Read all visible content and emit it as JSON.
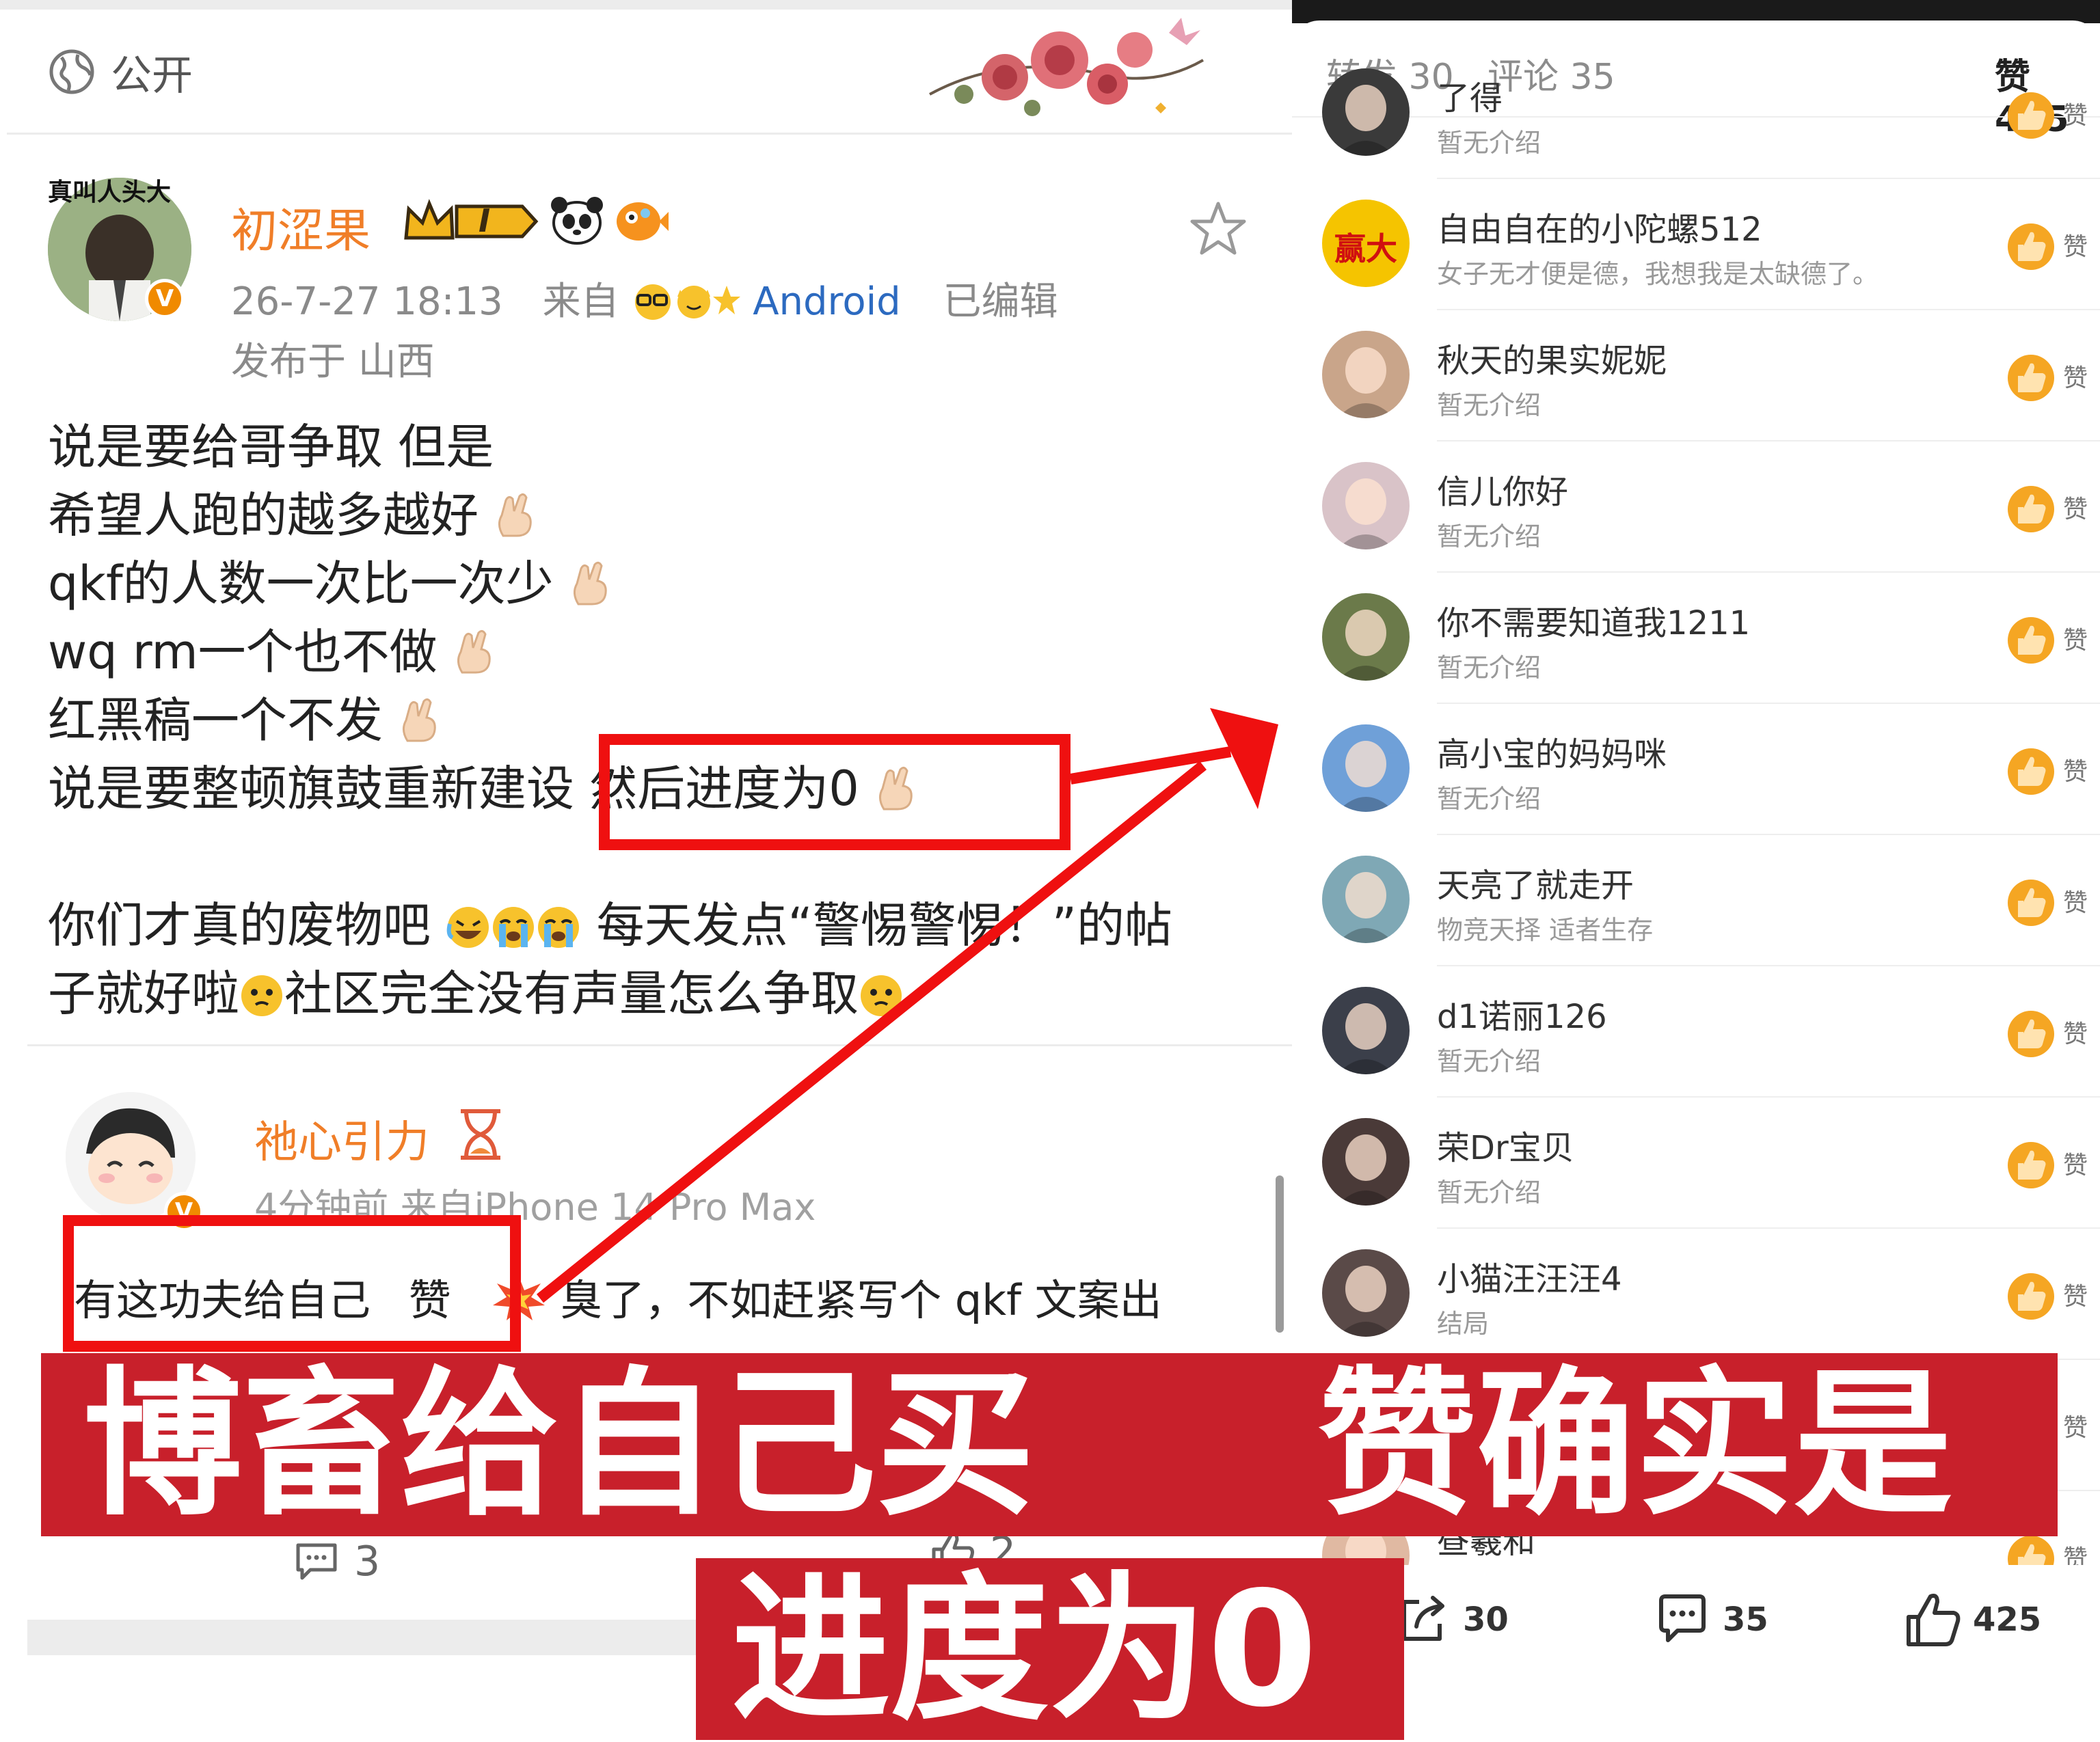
{
  "left_post": {
    "visibility": "公开",
    "author": "初涩果",
    "avatar_caption": "真叫人头大",
    "rank_badge": "I",
    "timestamp": "26-7-27 18:13",
    "source_prefix": "来自",
    "source_device": "Android",
    "edited": "已编辑",
    "location": "发布于 山西",
    "lines": [
      "说是要给哥争取 但是",
      "希望人跑的越多越好",
      "qkf的人数一次比一次少",
      "wq rm一个也不做",
      "红黑稿一个不发",
      "说是要整顿旗鼓重新建设 然后进度为0",
      "",
      "你们才真的废物吧",
      "每天发点“警惕警惕！”的帖",
      "子就好啦",
      "社区完全没有声量怎么争取"
    ],
    "highlight_text": "然后进度为0"
  },
  "comment": {
    "author": "祂心引力",
    "meta": "4分钟前  来自iPhone 14 Pro Max",
    "text_part1": "有这功夫给自己",
    "text_part2": "赞",
    "text_part3": "臭了，不如赶紧写个 qkf 文案出",
    "reply_count": "3",
    "like_count": "2"
  },
  "right_panel": {
    "tabs": [
      {
        "label": "转发 30"
      },
      {
        "label": "评论 35"
      },
      {
        "label": "赞 425"
      }
    ],
    "like_label": "赞",
    "users": [
      {
        "name": "了得",
        "desc": "暂无介绍",
        "color": "#3a3a3a"
      },
      {
        "name": "自由自在的小陀螺512",
        "desc": "女子无才便是德，我想我是太缺德了。",
        "color": "#f5c400",
        "avatar_text": "赢大"
      },
      {
        "name": "秋天的果实妮妮",
        "desc": "暂无介绍",
        "color": "#c9a58a"
      },
      {
        "name": "信儿你好",
        "desc": "暂无介绍",
        "color": "#d9c3c8"
      },
      {
        "name": "你不需要知道我1211",
        "desc": "暂无介绍",
        "color": "#6b7a4a"
      },
      {
        "name": "高小宝的妈妈咪",
        "desc": "暂无介绍",
        "color": "#6fa0d8"
      },
      {
        "name": "天亮了就走开",
        "desc": "物竞天择 适者生存",
        "color": "#7fa8b5"
      },
      {
        "name": "d1诺丽126",
        "desc": "暂无介绍",
        "color": "#3b3f4a"
      },
      {
        "name": "荣Dr宝贝",
        "desc": "暂无介绍",
        "color": "#4a3a38"
      },
      {
        "name": "小猫汪汪汪4",
        "desc": "结局",
        "color": "#5a4a48"
      },
      {
        "name": "",
        "desc": "",
        "color": "#e9e3df"
      },
      {
        "name": "昼羲和",
        "desc": "",
        "color": "#e0b9a2"
      }
    ],
    "bottom": {
      "repost": "30",
      "comments": "35",
      "likes": "425"
    }
  },
  "caption": {
    "line1": "博畜给自己买",
    "line1b": "赞确实是",
    "line2": "进度为0"
  },
  "colors": {
    "accent_orange": "#f07e28",
    "annotation_red": "#ef1010",
    "banner_red": "#c8202b"
  }
}
